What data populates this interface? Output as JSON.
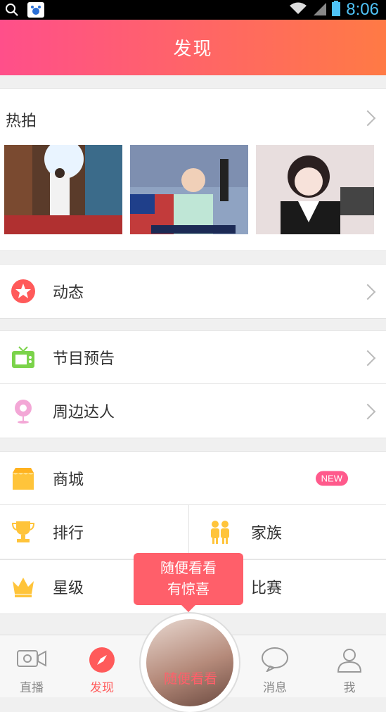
{
  "status_bar": {
    "time": "8:06"
  },
  "header": {
    "title": "发现"
  },
  "hot": {
    "title": "热拍"
  },
  "menu": {
    "dynamic": "动态",
    "program_preview": "节目预告",
    "nearby_people": "周边达人",
    "mall": "商城",
    "mall_badge": "NEW",
    "ranking": "排行",
    "family": "家族",
    "star_level": "星级",
    "match": "比赛"
  },
  "bubble": {
    "line1": "随便看看",
    "line2": "有惊喜"
  },
  "center_button": {
    "label": "随便看看"
  },
  "tabs": [
    {
      "label": "直播"
    },
    {
      "label": "发现"
    },
    {
      "label": "消息"
    },
    {
      "label": "我"
    }
  ],
  "colors": {
    "accent": "#ff5a78",
    "header_start": "#ff4f8a",
    "header_end": "#ff7a45"
  }
}
